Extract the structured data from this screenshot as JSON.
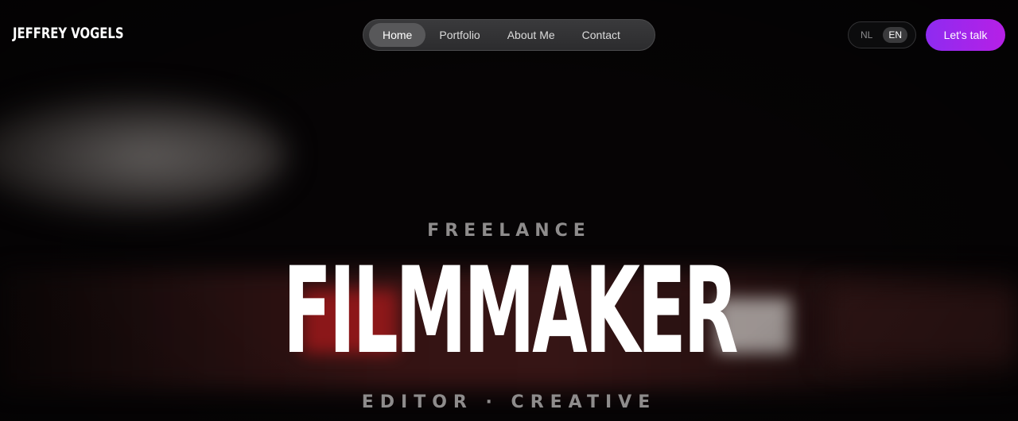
{
  "header": {
    "logo_text": "JEFFREY VOGELS"
  },
  "nav": {
    "items": [
      {
        "label": "Home",
        "active": true
      },
      {
        "label": "Portfolio",
        "active": false
      },
      {
        "label": "About Me",
        "active": false
      },
      {
        "label": "Contact",
        "active": false
      }
    ]
  },
  "language": {
    "options": [
      {
        "label": "NL",
        "active": false
      },
      {
        "label": "EN",
        "active": true
      }
    ]
  },
  "cta": {
    "label": "Let's talk",
    "color_start": "#8e2bf0",
    "color_end": "#b620e6"
  },
  "hero": {
    "eyebrow": "FREELANCE",
    "headline": "FILMMAKER",
    "subline": "EDITOR · CREATIVE"
  }
}
